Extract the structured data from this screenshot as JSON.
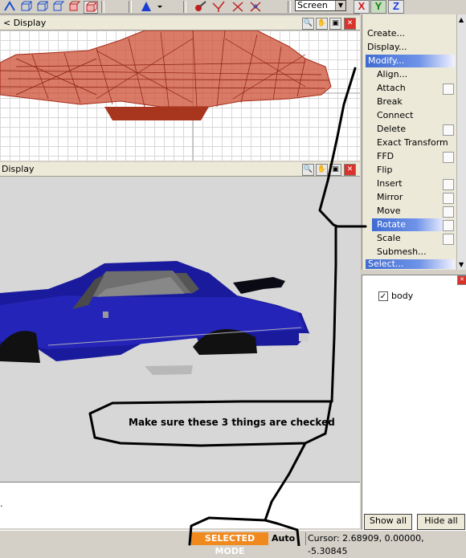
{
  "toolbar": {
    "screen_select": "Screen"
  },
  "axis": {
    "x": "X",
    "y": "Y",
    "z": "Z"
  },
  "viewports": {
    "top_title": "< Display",
    "persp_title": "Display"
  },
  "menu": {
    "create": "Create...",
    "display": "Display...",
    "modify": "Modify...",
    "items": [
      "Align...",
      "Attach",
      "Break",
      "Connect",
      "Delete",
      "Exact Transform",
      "FFD",
      "Flip",
      "Insert",
      "Mirror",
      "Move",
      "Rotate",
      "Scale",
      "Submesh..."
    ],
    "select": "Select..."
  },
  "list": {
    "item": "body",
    "show_all": "Show all",
    "hide_all": "Hide all"
  },
  "log": {
    "text": "."
  },
  "annotation": {
    "text": "Make sure these 3 things are checked"
  },
  "status": {
    "mode": "SELECTED MODE",
    "auto": "Auto",
    "cursor": "Cursor: 2.68909, 0.00000, -5.30845"
  },
  "colors": {
    "highlight": "#3f6bd1",
    "mode_badge": "#f08a1e",
    "car_body": "#1a1a9c",
    "wireframe": "#c0392b"
  }
}
